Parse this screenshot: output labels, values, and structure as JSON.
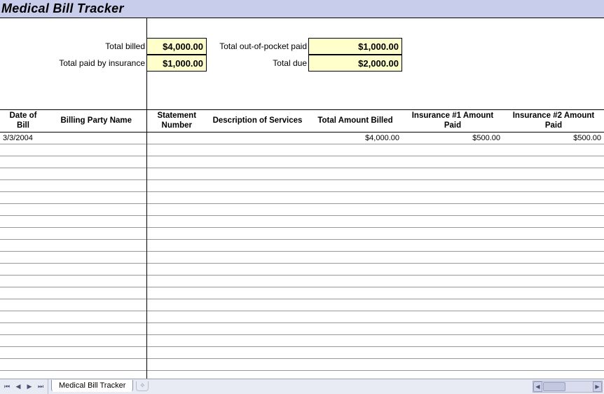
{
  "header": {
    "title": "Medical Bill Tracker"
  },
  "summary": {
    "total_billed_label": "Total billed",
    "total_billed_value": "$4,000.00",
    "total_paid_by_insurance_label": "Total paid by insurance",
    "total_paid_by_insurance_value": "$1,000.00",
    "total_out_of_pocket_label": "Total out-of-pocket paid",
    "total_out_of_pocket_value": "$1,000.00",
    "total_due_label": "Total due",
    "total_due_value": "$2,000.00"
  },
  "table": {
    "columns": {
      "date": "Date of Bill",
      "party": "Billing Party Name",
      "stmt": "Statement Number",
      "desc": "Description of Services",
      "total": "Total Amount Billed",
      "ins1": "Insurance #1 Amount Paid",
      "ins2": "Insurance #2 Amount Paid"
    },
    "rows": [
      {
        "date": "3/3/2004",
        "party": "",
        "stmt": "",
        "desc": "",
        "total": "$4,000.00",
        "ins1": "$500.00",
        "ins2": "$500.00"
      },
      {
        "date": "",
        "party": "",
        "stmt": "",
        "desc": "",
        "total": "",
        "ins1": "",
        "ins2": ""
      },
      {
        "date": "",
        "party": "",
        "stmt": "",
        "desc": "",
        "total": "",
        "ins1": "",
        "ins2": ""
      },
      {
        "date": "",
        "party": "",
        "stmt": "",
        "desc": "",
        "total": "",
        "ins1": "",
        "ins2": ""
      },
      {
        "date": "",
        "party": "",
        "stmt": "",
        "desc": "",
        "total": "",
        "ins1": "",
        "ins2": ""
      },
      {
        "date": "",
        "party": "",
        "stmt": "",
        "desc": "",
        "total": "",
        "ins1": "",
        "ins2": ""
      },
      {
        "date": "",
        "party": "",
        "stmt": "",
        "desc": "",
        "total": "",
        "ins1": "",
        "ins2": ""
      },
      {
        "date": "",
        "party": "",
        "stmt": "",
        "desc": "",
        "total": "",
        "ins1": "",
        "ins2": ""
      },
      {
        "date": "",
        "party": "",
        "stmt": "",
        "desc": "",
        "total": "",
        "ins1": "",
        "ins2": ""
      },
      {
        "date": "",
        "party": "",
        "stmt": "",
        "desc": "",
        "total": "",
        "ins1": "",
        "ins2": ""
      },
      {
        "date": "",
        "party": "",
        "stmt": "",
        "desc": "",
        "total": "",
        "ins1": "",
        "ins2": ""
      },
      {
        "date": "",
        "party": "",
        "stmt": "",
        "desc": "",
        "total": "",
        "ins1": "",
        "ins2": ""
      },
      {
        "date": "",
        "party": "",
        "stmt": "",
        "desc": "",
        "total": "",
        "ins1": "",
        "ins2": ""
      },
      {
        "date": "",
        "party": "",
        "stmt": "",
        "desc": "",
        "total": "",
        "ins1": "",
        "ins2": ""
      },
      {
        "date": "",
        "party": "",
        "stmt": "",
        "desc": "",
        "total": "",
        "ins1": "",
        "ins2": ""
      },
      {
        "date": "",
        "party": "",
        "stmt": "",
        "desc": "",
        "total": "",
        "ins1": "",
        "ins2": ""
      },
      {
        "date": "",
        "party": "",
        "stmt": "",
        "desc": "",
        "total": "",
        "ins1": "",
        "ins2": ""
      },
      {
        "date": "",
        "party": "",
        "stmt": "",
        "desc": "",
        "total": "",
        "ins1": "",
        "ins2": ""
      },
      {
        "date": "",
        "party": "",
        "stmt": "",
        "desc": "",
        "total": "",
        "ins1": "",
        "ins2": ""
      },
      {
        "date": "",
        "party": "",
        "stmt": "",
        "desc": "",
        "total": "",
        "ins1": "",
        "ins2": ""
      }
    ]
  },
  "tabs": {
    "active": "Medical Bill Tracker"
  }
}
